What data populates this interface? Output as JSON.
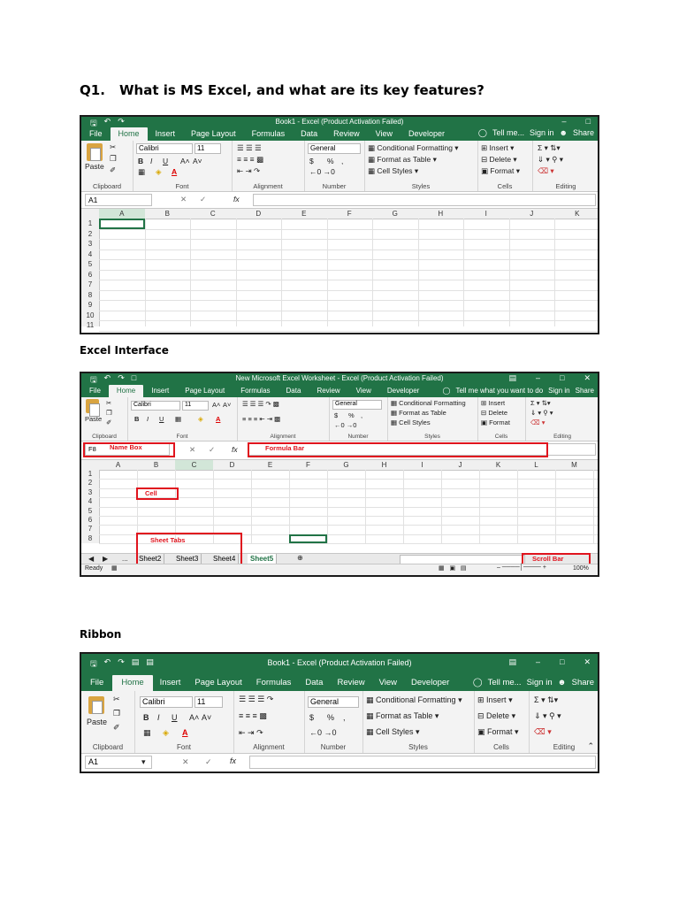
{
  "question": {
    "number": "Q1.",
    "text": "What is MS Excel, and what are its key features?"
  },
  "captions": {
    "interface": "Excel Interface",
    "ribbon": "Ribbon"
  },
  "ribbon_common": {
    "tabs": [
      "File",
      "Home",
      "Insert",
      "Page Layout",
      "Formulas",
      "Data",
      "Review",
      "View",
      "Developer"
    ],
    "font_name": "Calibri",
    "font_size": "11",
    "paste": "Paste",
    "number_format": "General",
    "conditional_formatting": "Conditional Formatting",
    "format_as_table": "Format as Table",
    "cell_styles": "Cell Styles",
    "insert": "Insert",
    "delete": "Delete",
    "format": "Format",
    "bold": "B",
    "italic": "I",
    "underline": "U",
    "grow": "A˄",
    "shrink": "A˅",
    "currency": "$",
    "percent": "%",
    "comma": ",",
    "groups": [
      "Clipboard",
      "Font",
      "Alignment",
      "Number",
      "Styles",
      "Cells",
      "Editing"
    ]
  },
  "shot1": {
    "title": "Book1 - Excel (Product Activation Failed)",
    "tell_me": "Tell me...",
    "sign_in": "Sign in",
    "share": "Share",
    "name_box": "A1",
    "fx": "fx",
    "columns": [
      "A",
      "B",
      "C",
      "D",
      "E",
      "F",
      "G",
      "H",
      "I",
      "J",
      "K"
    ],
    "rows": [
      "1",
      "2",
      "3",
      "4",
      "5",
      "6",
      "7",
      "8",
      "9",
      "10",
      "11"
    ]
  },
  "shot2": {
    "title": "New Microsoft Excel Worksheet - Excel (Product Activation Failed)",
    "tell_me": "Tell me what you want to do",
    "sign_in": "Sign in",
    "share": "Share",
    "name_box": "F8",
    "fx": "fx",
    "columns": [
      "A",
      "B",
      "C",
      "D",
      "E",
      "F",
      "G",
      "H",
      "I",
      "J",
      "K",
      "L",
      "M"
    ],
    "rows": [
      "1",
      "2",
      "3",
      "4",
      "5",
      "6",
      "7",
      "8"
    ],
    "sheets": [
      "Sheet2",
      "Sheet3",
      "Sheet4",
      "Sheet5"
    ],
    "ellipsis": "...",
    "status": "Ready",
    "zoom": "100%",
    "labels": {
      "name_box": "Name Box",
      "formula_bar": "Formula Bar",
      "cell": "Cell",
      "sheet_tabs": "Sheet Tabs",
      "scroll_bar": "Scroll Bar"
    }
  },
  "shot3": {
    "title": "Book1 - Excel (Product Activation Failed)",
    "tell_me": "Tell me...",
    "sign_in": "Sign in",
    "share": "Share",
    "name_box": "A1",
    "fx": "fx"
  },
  "colors": {
    "excel_green": "#217346",
    "annotation_red": "#e0141e"
  }
}
